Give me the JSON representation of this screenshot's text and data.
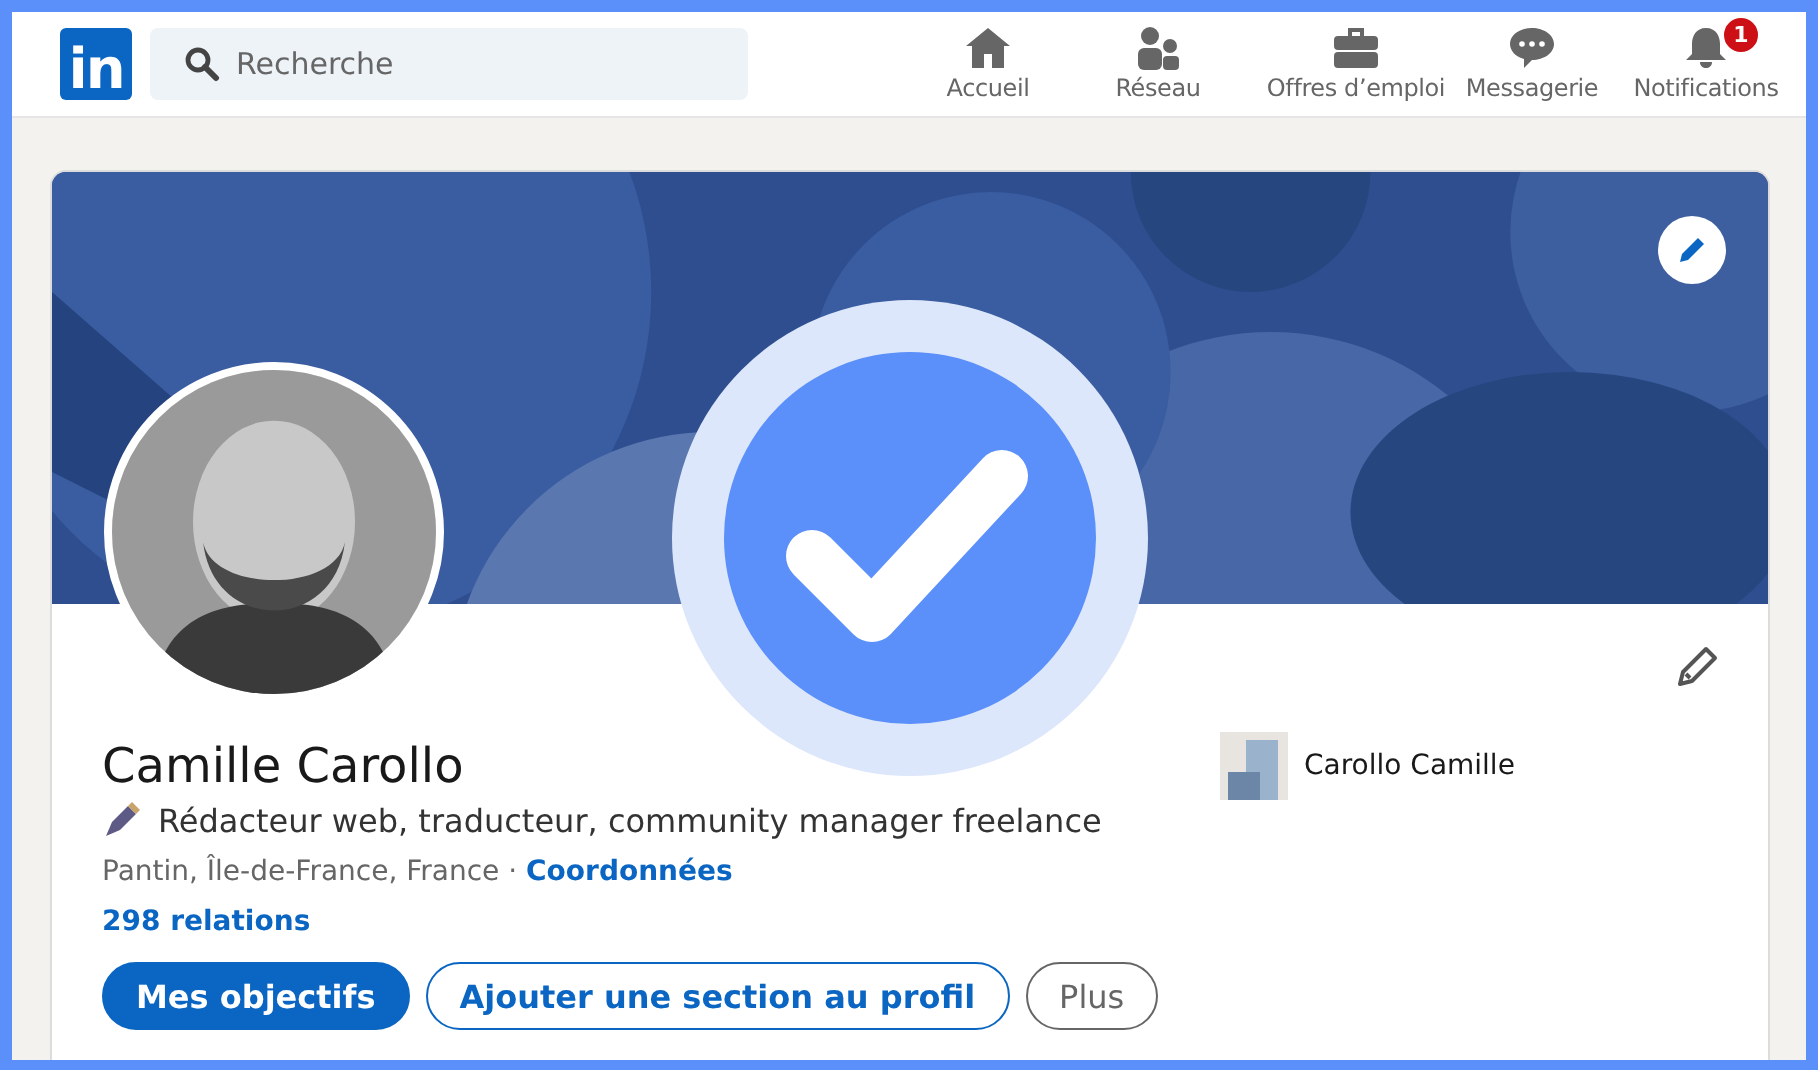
{
  "header": {
    "logo": "in",
    "search": {
      "placeholder": "Recherche"
    },
    "nav": [
      {
        "kind": "home",
        "label": "Accueil"
      },
      {
        "kind": "network",
        "label": "Réseau"
      },
      {
        "kind": "jobs",
        "label": "Offres d’emploi"
      },
      {
        "kind": "messages",
        "label": "Messagerie"
      },
      {
        "kind": "notifications",
        "label": "Notifications",
        "badge": "1"
      }
    ]
  },
  "profile": {
    "name": "Camille Carollo",
    "headline": "Rédacteur web, traducteur, community manager freelance",
    "location": "Pantin, Île-de-France, France",
    "separator": "·",
    "contact_link": "Coordonnées",
    "connections": "298 relations",
    "company": "Carollo Camille",
    "buttons": [
      {
        "kind": "primary",
        "label": "Mes objectifs"
      },
      {
        "kind": "outline",
        "label": "Ajouter une section au profil"
      },
      {
        "kind": "secondary",
        "label": "Plus"
      }
    ]
  }
}
